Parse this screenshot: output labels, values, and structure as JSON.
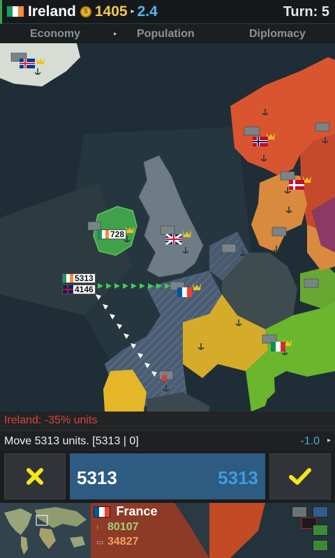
{
  "topbar": {
    "country": "Ireland",
    "gold": "1405",
    "income": "2.4",
    "turn": "Turn: 5"
  },
  "tabs": [
    "Economy",
    "Population",
    "Diplomacy"
  ],
  "map": {
    "labels": {
      "ireland_army": "728",
      "source_army": "5313",
      "enemy_army": "4146"
    }
  },
  "messages": {
    "penalty": "Ireland: -35% units",
    "move": "Move 5313 units. [5313 | 0]",
    "modifier": "-1.0"
  },
  "amount": {
    "value": "5313",
    "max": "5313",
    "fill_fraction": 1.0
  },
  "target": {
    "country": "France",
    "population": "80107",
    "army": "34827"
  },
  "colors": {
    "ireland": "#3fa14a",
    "uk": "#6b7a82",
    "france": "#3a4d66",
    "germany_yellow": "#d5ac2a",
    "norway": "#d9552f",
    "denmark": "#d98a3f",
    "italy": "#6ab72e",
    "accent_blue": "#3d9ed9"
  },
  "icons": [
    "gold-coin-icon",
    "cancel-x-icon",
    "confirm-check-icon",
    "population-icon",
    "army-icon",
    "castle-icon",
    "crown-icon",
    "anchor-icon"
  ]
}
